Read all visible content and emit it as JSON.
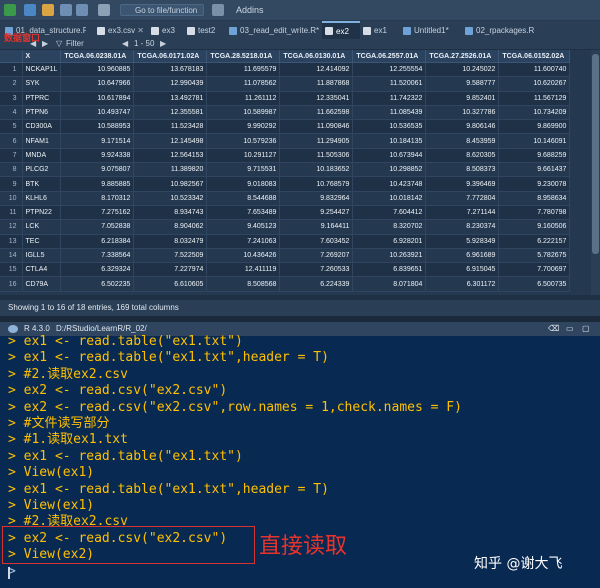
{
  "toolbar": {
    "goto_placeholder": "Go to file/function",
    "addins_label": "Addins"
  },
  "tabs": [
    {
      "label": "01_data_structure.R"
    },
    {
      "label": "ex3.csv"
    },
    {
      "label": "ex3"
    },
    {
      "label": "test2"
    },
    {
      "label": "03_read_edit_write.R*"
    },
    {
      "label": "ex2"
    },
    {
      "label": "ex1"
    },
    {
      "label": "Untitled1*"
    },
    {
      "label": "02_rpackages.R"
    }
  ],
  "viewer": {
    "overlay_text": "数据窗口",
    "filter_label": "Filter",
    "range_label": "1 - 50"
  },
  "grid": {
    "columns": [
      "",
      "X",
      "TCGA.06.0238.01A",
      "TCGA.06.0171.02A",
      "TCGA.28.5218.01A",
      "TCGA.06.0130.01A",
      "TCGA.06.2557.01A",
      "TCGA.27.2526.01A",
      "TCGA.06.0152.02A"
    ],
    "rows": [
      [
        "1",
        "NCKAP1L",
        "10.960885",
        "13.678183",
        "11.695579",
        "12.414092",
        "12.255554",
        "10.245022",
        "11.600740"
      ],
      [
        "2",
        "SYK",
        "10.647966",
        "12.990439",
        "11.078562",
        "11.887868",
        "11.520061",
        "9.588777",
        "10.620267"
      ],
      [
        "3",
        "PTPRC",
        "10.617894",
        "13.492781",
        "11.261112",
        "12.335041",
        "11.742322",
        "9.852401",
        "11.567129"
      ],
      [
        "4",
        "PTPN6",
        "10.493747",
        "12.355581",
        "10.589987",
        "11.662598",
        "11.085439",
        "10.327786",
        "10.734209"
      ],
      [
        "5",
        "CD300A",
        "10.588953",
        "11.523428",
        "9.990292",
        "11.090846",
        "10.536535",
        "9.806146",
        "9.869900"
      ],
      [
        "6",
        "NFAM1",
        "9.171514",
        "12.145498",
        "10.579236",
        "11.294905",
        "10.184135",
        "8.453959",
        "10.146091"
      ],
      [
        "7",
        "MNDA",
        "9.924338",
        "12.564153",
        "10.291127",
        "11.505306",
        "10.673944",
        "8.620305",
        "9.688259"
      ],
      [
        "8",
        "PLCG2",
        "9.075807",
        "11.389820",
        "9.715531",
        "10.183652",
        "10.298852",
        "8.508373",
        "9.661437"
      ],
      [
        "9",
        "BTK",
        "9.885885",
        "10.982567",
        "9.018083",
        "10.768579",
        "10.423748",
        "9.396469",
        "9.230078"
      ],
      [
        "10",
        "KLHL6",
        "8.170312",
        "10.523342",
        "8.544688",
        "9.832964",
        "10.018142",
        "7.772804",
        "8.958634"
      ],
      [
        "11",
        "PTPN22",
        "7.275162",
        "8.934743",
        "7.653489",
        "9.254427",
        "7.604412",
        "7.271144",
        "7.780798"
      ],
      [
        "12",
        "LCK",
        "7.052838",
        "8.904062",
        "9.405123",
        "9.164411",
        "8.320702",
        "8.230374",
        "9.160506"
      ],
      [
        "13",
        "TEC",
        "6.218384",
        "8.032479",
        "7.241063",
        "7.603452",
        "6.928201",
        "5.928349",
        "6.222157"
      ],
      [
        "14",
        "IGLL5",
        "7.338564",
        "7.522509",
        "10.436426",
        "7.269207",
        "10.263921",
        "6.961689",
        "5.782675"
      ],
      [
        "15",
        "CTLA4",
        "6.329324",
        "7.227974",
        "12.411119",
        "7.260533",
        "6.839651",
        "6.915045",
        "7.700697"
      ],
      [
        "16",
        "CD79A",
        "6.502235",
        "6.610605",
        "8.508568",
        "6.224339",
        "8.071804",
        "6.301172",
        "6.500735"
      ]
    ]
  },
  "status_text": "Showing 1 to 16 of 18 entries, 169 total columns",
  "console_header": {
    "r_version": "R 4.3.0",
    "path": "D:/RStudio/LearnR/R_02/"
  },
  "console_lines": [
    "> ex1 <- read.table(\"ex1.txt\")",
    "> ex1 <- read.table(\"ex1.txt\",header = T)",
    "> #2.读取ex2.csv",
    "> ex2 <- read.csv(\"ex2.csv\")",
    "> ex2 <- read.csv(\"ex2.csv\",row.names = 1,check.names = F)",
    "> #文件读写部分",
    "> #1.读取ex1.txt",
    "> ex1 <- read.table(\"ex1.txt\")",
    "> View(ex1)",
    "> ex1 <- read.table(\"ex1.txt\",header = T)",
    "> View(ex1)",
    "> #2.读取ex2.csv",
    "> ex2 <- read.csv(\"ex2.csv\")",
    "> View(ex2)",
    ">"
  ],
  "annotation": "直接读取",
  "watermark": "知乎 @谢大飞",
  "colors": {
    "console_bg": "#082a52",
    "console_text": "#ffc000",
    "annotation_red": "#e8332c"
  }
}
